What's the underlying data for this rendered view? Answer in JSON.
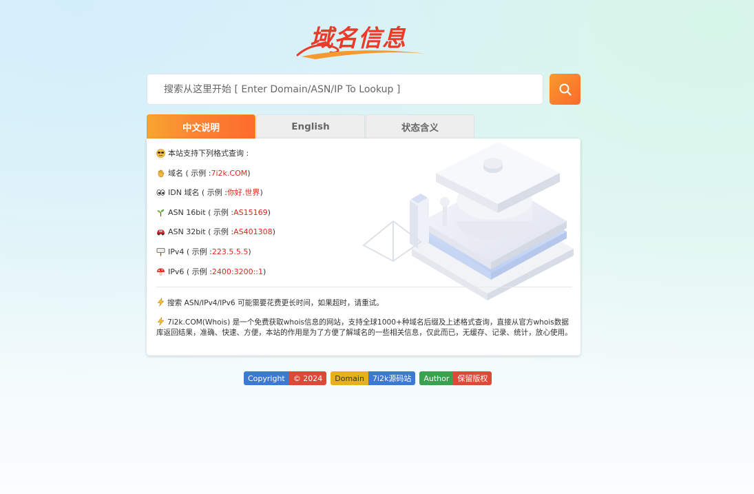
{
  "logo": {
    "text": "域名信息"
  },
  "search": {
    "placeholder": "搜索从这里开始 [ Enter Domain/ASN/IP To Lookup ]"
  },
  "tabs": [
    {
      "label": "中文说明",
      "active": true
    },
    {
      "label": "English",
      "active": false
    },
    {
      "label": "状态含义",
      "active": false
    }
  ],
  "panel": {
    "intro": "本站支持下列格式查询 :",
    "examples": [
      {
        "icon": "sunglasses-icon",
        "prefix": "域名 ( 示例 : ",
        "value": "7i2k.COM",
        "suffix": " )"
      },
      {
        "icon": "eyes-icon",
        "prefix": "IDN 域名 ( 示例 : ",
        "value": "你好.世界",
        "suffix": " )"
      },
      {
        "icon": "sprout-icon",
        "prefix": "ASN 16bit ( 示例 : ",
        "value": "AS15169",
        "suffix": " )"
      },
      {
        "icon": "car-icon",
        "prefix": "ASN 32bit ( 示例 : ",
        "value": "AS401308",
        "suffix": " )"
      },
      {
        "icon": "sign-icon",
        "prefix": "IPv4 ( 示例 : ",
        "value": "223.5.5.5",
        "suffix": " )"
      },
      {
        "icon": "mushroom-icon",
        "prefix": "IPv6 ( 示例 : ",
        "value": "2400:3200::1",
        "suffix": " )"
      }
    ],
    "note1": "搜索 ASN/IPv4/IPv6 可能需要花费更长时间，如果超时，请重试。",
    "note2": "7i2k.COM(Whois) 是一个免费获取whois信息的网站，支持全球1000+种域名后缀及上述格式查询，直接从官方whois数据库返回结果，准确、快速、方便，本站的作用是为了方便了解域名的一些相关信息，仅此而已，无缓存、记录、统计，放心使用。"
  },
  "badges": [
    {
      "left": "Copyright",
      "right": "© 2024"
    },
    {
      "left": "Domain",
      "right": "7i2k源码站"
    },
    {
      "left": "Author",
      "right": "保留版权"
    }
  ],
  "colors": {
    "accent": "#fb7a2e",
    "red_text": "#e0261b"
  }
}
